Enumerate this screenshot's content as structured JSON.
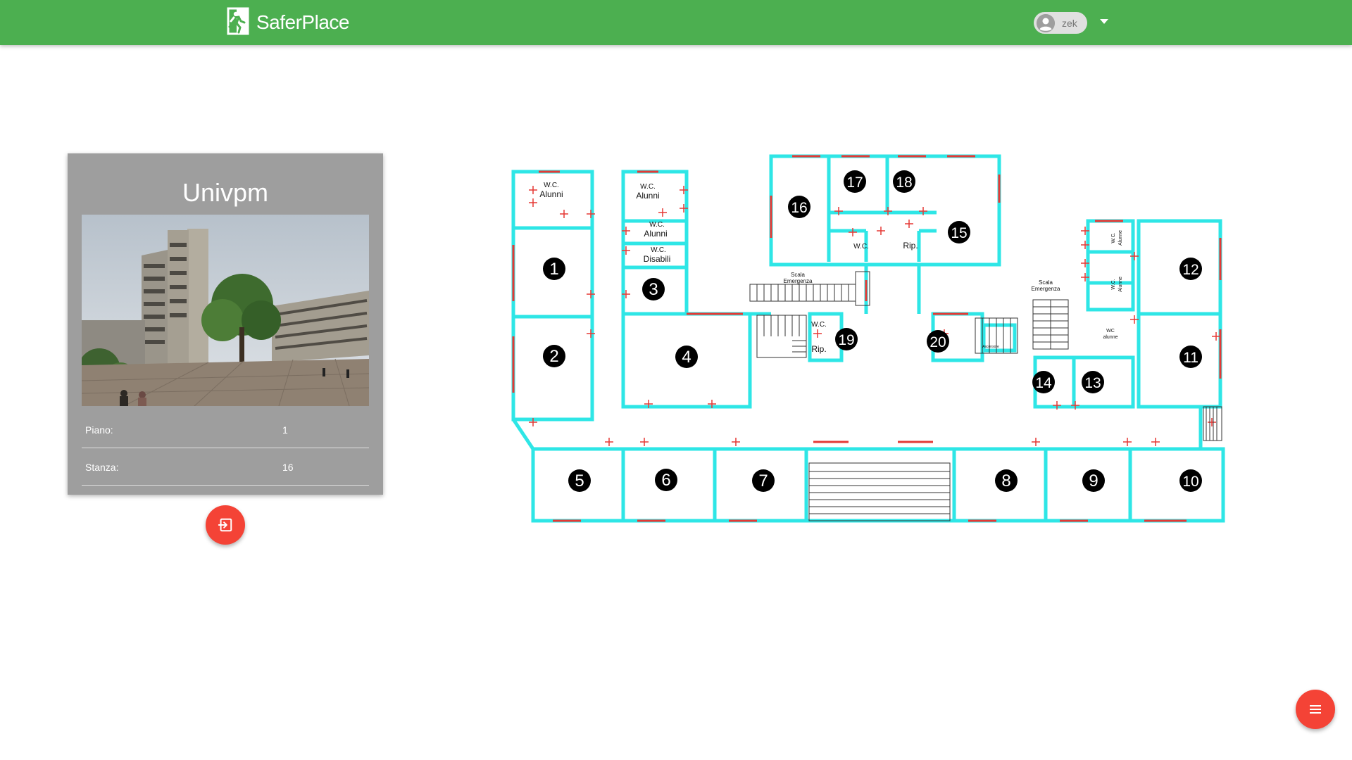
{
  "header": {
    "brand": "SaferPlace",
    "user_name": "zek"
  },
  "card": {
    "title": "Univpm",
    "rows": [
      {
        "label": "Piano:",
        "value": "1"
      },
      {
        "label": "Stanza:",
        "value": "16"
      }
    ]
  },
  "floor_plan": {
    "room_numbers": [
      "1",
      "2",
      "3",
      "4",
      "5",
      "6",
      "7",
      "8",
      "9",
      "10",
      "11",
      "12",
      "13",
      "14",
      "15",
      "16",
      "17",
      "18",
      "19",
      "20"
    ],
    "labels": {
      "wc_alunni_1": "W.C.",
      "wc_alunni_1b": "Alunni",
      "wc_alunni_2": "W.C.",
      "wc_alunni_2b": "Alunni",
      "wc_alunni_3": "W.C.",
      "wc_alunni_3b": "Alunni",
      "wc_disabili": "W.C.",
      "wc_disabili_b": "Disabili",
      "wc_top": "W.C.",
      "rip_top": "Rip.",
      "scala_emergenza_1": "Scala",
      "scala_emergenza_1b": "Emergenza",
      "scala_emergenza_2": "Scala",
      "scala_emergenza_2b": "Emergenza",
      "wc_mid": "W.C.",
      "rip_mid": "Rip.",
      "ascensore": "Ascensore",
      "wc_right_1": "W.C.",
      "wc_right_1b": "Alunne",
      "wc_right_2": "W.C.",
      "wc_right_2b": "Alunne",
      "wc_alunne": "WC",
      "wc_alunne_b": "alunne"
    }
  },
  "colors": {
    "topbar": "#4caf50",
    "fab": "#f44336",
    "card": "#9e9e9e",
    "wall": "#2ee6e6",
    "window": "#e53935"
  },
  "icons": {
    "logo": "exit-running-man-icon",
    "avatar": "account-circle-icon",
    "dropdown": "arrow-drop-down-icon",
    "exit": "exit-to-app-icon",
    "menu": "menu-icon"
  }
}
